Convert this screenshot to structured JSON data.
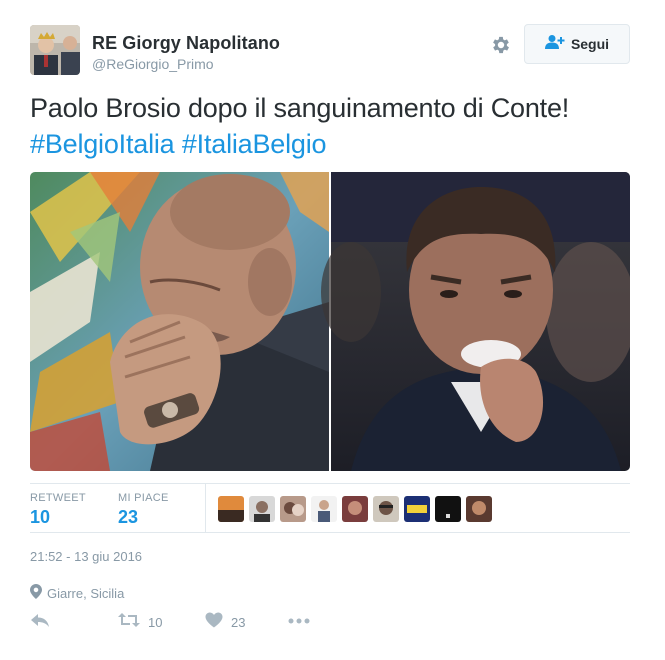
{
  "tweet": {
    "display_name": "RE Giorgy Napolitano",
    "handle": "@ReGiorgio_Primo",
    "text_main": "Paolo Brosio dopo il sanguinamento di Conte!",
    "hashtags": [
      "#BelgioItalia",
      "#ItaliaBelgio"
    ],
    "timestamp": "21:52 - 13 giu 2016",
    "location": "Giarre, Sicilia"
  },
  "header": {
    "follow_label": "Segui",
    "settings_icon": "gear-icon",
    "follow_icon": "person-plus-icon"
  },
  "stats": {
    "retweet_label": "RETWEET",
    "retweet_count": "10",
    "like_label": "MI PIACE",
    "like_count": "23",
    "liker_avatars": 9
  },
  "actions": {
    "reply_icon": "reply-icon",
    "retweet_icon": "retweet-icon",
    "retweet_count": "10",
    "like_icon": "heart-icon",
    "like_count": "23",
    "more_icon": "more-icon"
  },
  "colors": {
    "link": "#1b95e0",
    "text": "#292f33",
    "muted": "#8899a6",
    "border": "#e1e8ed",
    "action_icon": "#aab8c2"
  }
}
